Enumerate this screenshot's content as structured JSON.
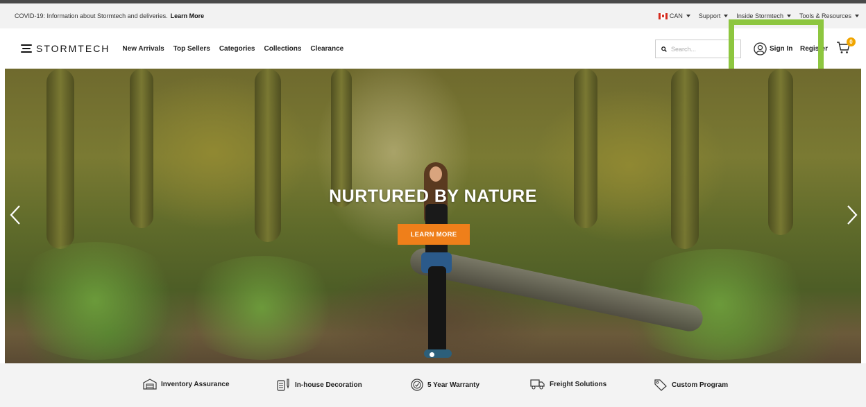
{
  "announcement": {
    "message": "COVID-19: Information about Stormtech and deliveries.",
    "link": "Learn More"
  },
  "utility_nav": {
    "country": "CAN",
    "support": "Support",
    "inside": "Inside Stormtech",
    "tools": "Tools & Resources"
  },
  "header": {
    "brand": "STORMTECH",
    "nav": [
      "New Arrivals",
      "Top Sellers",
      "Categories",
      "Collections",
      "Clearance"
    ],
    "search_placeholder": "Search...",
    "sign_in": "Sign In",
    "register": "Register",
    "cart_count": "0"
  },
  "hero": {
    "title": "NURTURED BY NATURE",
    "cta": "LEARN MORE"
  },
  "features": [
    {
      "label": "Inventory Assurance",
      "icon": "warehouse-icon"
    },
    {
      "label": "In-house Decoration",
      "icon": "decoration-icon"
    },
    {
      "label": "5 Year Warranty",
      "icon": "warranty-icon"
    },
    {
      "label": "Freight Solutions",
      "icon": "truck-icon"
    },
    {
      "label": "Custom Program",
      "icon": "tag-icon"
    }
  ],
  "colors": {
    "accent_orange": "#ef7f1a",
    "cart_badge": "#f0a500",
    "highlight_green": "#8dc63f",
    "flag_red": "#d52b1e"
  }
}
